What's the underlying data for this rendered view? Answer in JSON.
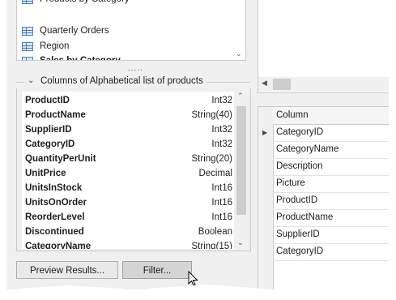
{
  "views": {
    "items": [
      {
        "label": "Products by Category",
        "icon": "table-icon"
      },
      {
        "label": "Quarterly Orders",
        "icon": "table-icon"
      },
      {
        "label": "Region",
        "icon": "table-icon"
      },
      {
        "label": "Sales by Category",
        "icon": "table-icon"
      }
    ]
  },
  "splitter": {
    "dots": "....."
  },
  "columns_group": {
    "title": "Columns of Alphabetical list of products",
    "rows": [
      {
        "name": "ProductID",
        "type": "Int32"
      },
      {
        "name": "ProductName",
        "type": "String(40)"
      },
      {
        "name": "SupplierID",
        "type": "Int32"
      },
      {
        "name": "CategoryID",
        "type": "Int32"
      },
      {
        "name": "QuantityPerUnit",
        "type": "String(20)"
      },
      {
        "name": "UnitPrice",
        "type": "Decimal"
      },
      {
        "name": "UnitsInStock",
        "type": "Int16"
      },
      {
        "name": "UnitsOnOrder",
        "type": "Int16"
      },
      {
        "name": "ReorderLevel",
        "type": "Int16"
      },
      {
        "name": "Discontinued",
        "type": "Boolean"
      },
      {
        "name": "CategoryName",
        "type": "String(15)"
      }
    ]
  },
  "buttons": {
    "preview": "Preview Results...",
    "filter": "Filter..."
  },
  "grid": {
    "header": "Column",
    "rows": [
      "CategoryID",
      "CategoryName",
      "Description",
      "Picture",
      "ProductID",
      "ProductName",
      "SupplierID",
      "CategoryID"
    ]
  }
}
